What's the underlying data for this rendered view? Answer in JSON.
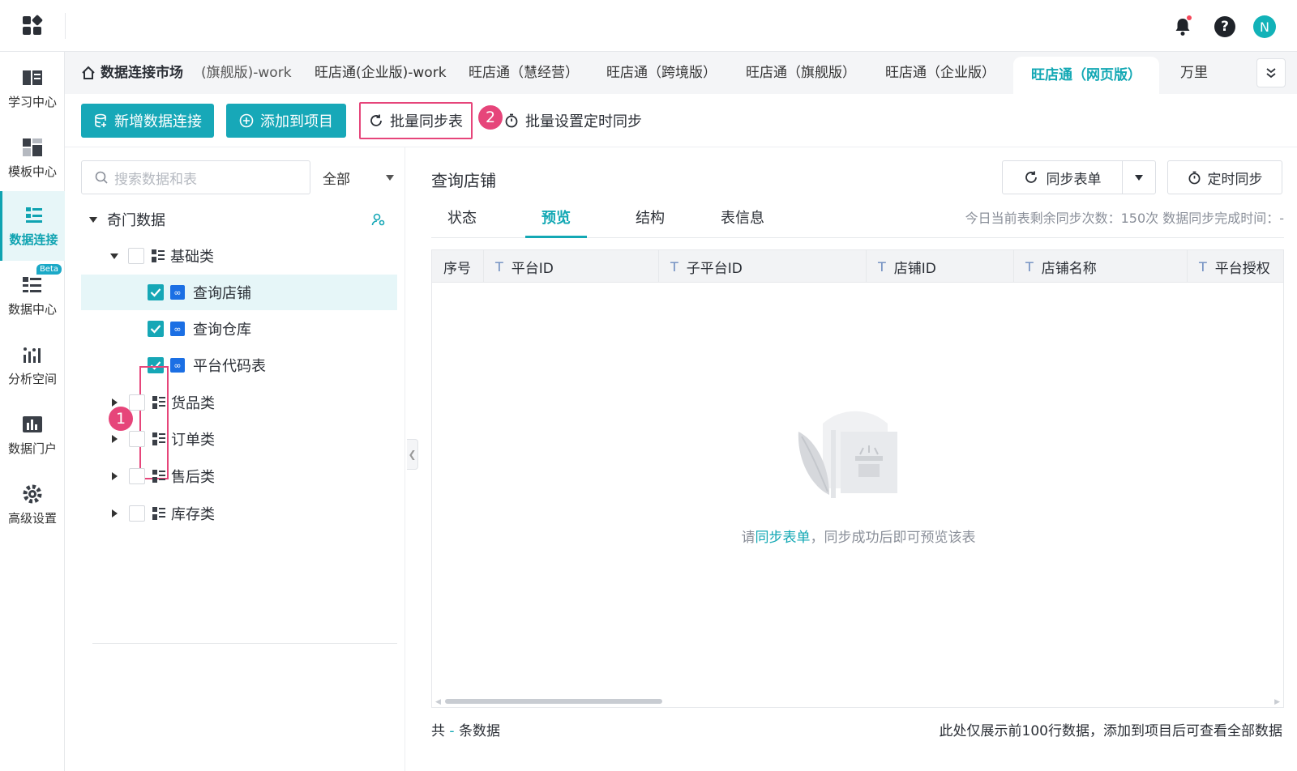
{
  "nav": {
    "items": [
      {
        "label": "学习中心",
        "icon": "book-icon"
      },
      {
        "label": "模板中心",
        "icon": "template-icon"
      },
      {
        "label": "数据连接",
        "icon": "data-connect-icon"
      },
      {
        "label": "数据中心",
        "icon": "data-center-icon",
        "badge": "Beta"
      },
      {
        "label": "分析空间",
        "icon": "analysis-icon"
      },
      {
        "label": "数据门户",
        "icon": "portal-icon"
      },
      {
        "label": "高级设置",
        "icon": "gear-icon"
      }
    ]
  },
  "user": {
    "avatar_letter": "N",
    "help": "?"
  },
  "tabs": {
    "home": "数据连接市场",
    "items": [
      "(旗舰版)-work",
      "旺店通(企业版)-work",
      "旺店通（慧经营）",
      "旺店通（跨境版）",
      "旺店通（旗舰版）",
      "旺店通（企业版）",
      "旺店通（网页版）",
      "万里"
    ]
  },
  "toolbar": {
    "add_connection": "新增数据连接",
    "add_to_project": "添加到项目",
    "batch_sync": "批量同步表",
    "batch_schedule": "批量设置定时同步",
    "marker1": "1",
    "marker2": "2"
  },
  "tree": {
    "search_placeholder": "搜索数据和表",
    "filter": "全部",
    "root": "奇门数据",
    "groups": [
      {
        "label": "基础类",
        "expanded": true,
        "children": [
          "查询店铺",
          "查询仓库",
          "平台代码表"
        ]
      },
      {
        "label": "货品类",
        "expanded": false
      },
      {
        "label": "订单类",
        "expanded": false
      },
      {
        "label": "售后类",
        "expanded": false
      },
      {
        "label": "库存类",
        "expanded": false
      }
    ]
  },
  "detail": {
    "title": "查询店铺",
    "sync_button": "同步表单",
    "timer_button": "定时同步",
    "subtabs": [
      "状态",
      "预览",
      "结构",
      "表信息"
    ],
    "sync_info": "今日当前表剩余同步次数：150次   数据同步完成时间：-",
    "columns": [
      "序号",
      "平台ID",
      "子平台ID",
      "店铺ID",
      "店铺名称",
      "平台授权"
    ],
    "empty_pre": "请",
    "empty_link": "同步表单",
    "empty_post": "，同步成功后即可预览该表",
    "footer_pre": "共",
    "footer_dash": "-",
    "footer_post": "条数据",
    "footer_note": "此处仅展示前100行数据，添加到项目后可查看全部数据"
  },
  "colors": {
    "accent": "#17a8b8",
    "highlight": "#e6457a"
  }
}
